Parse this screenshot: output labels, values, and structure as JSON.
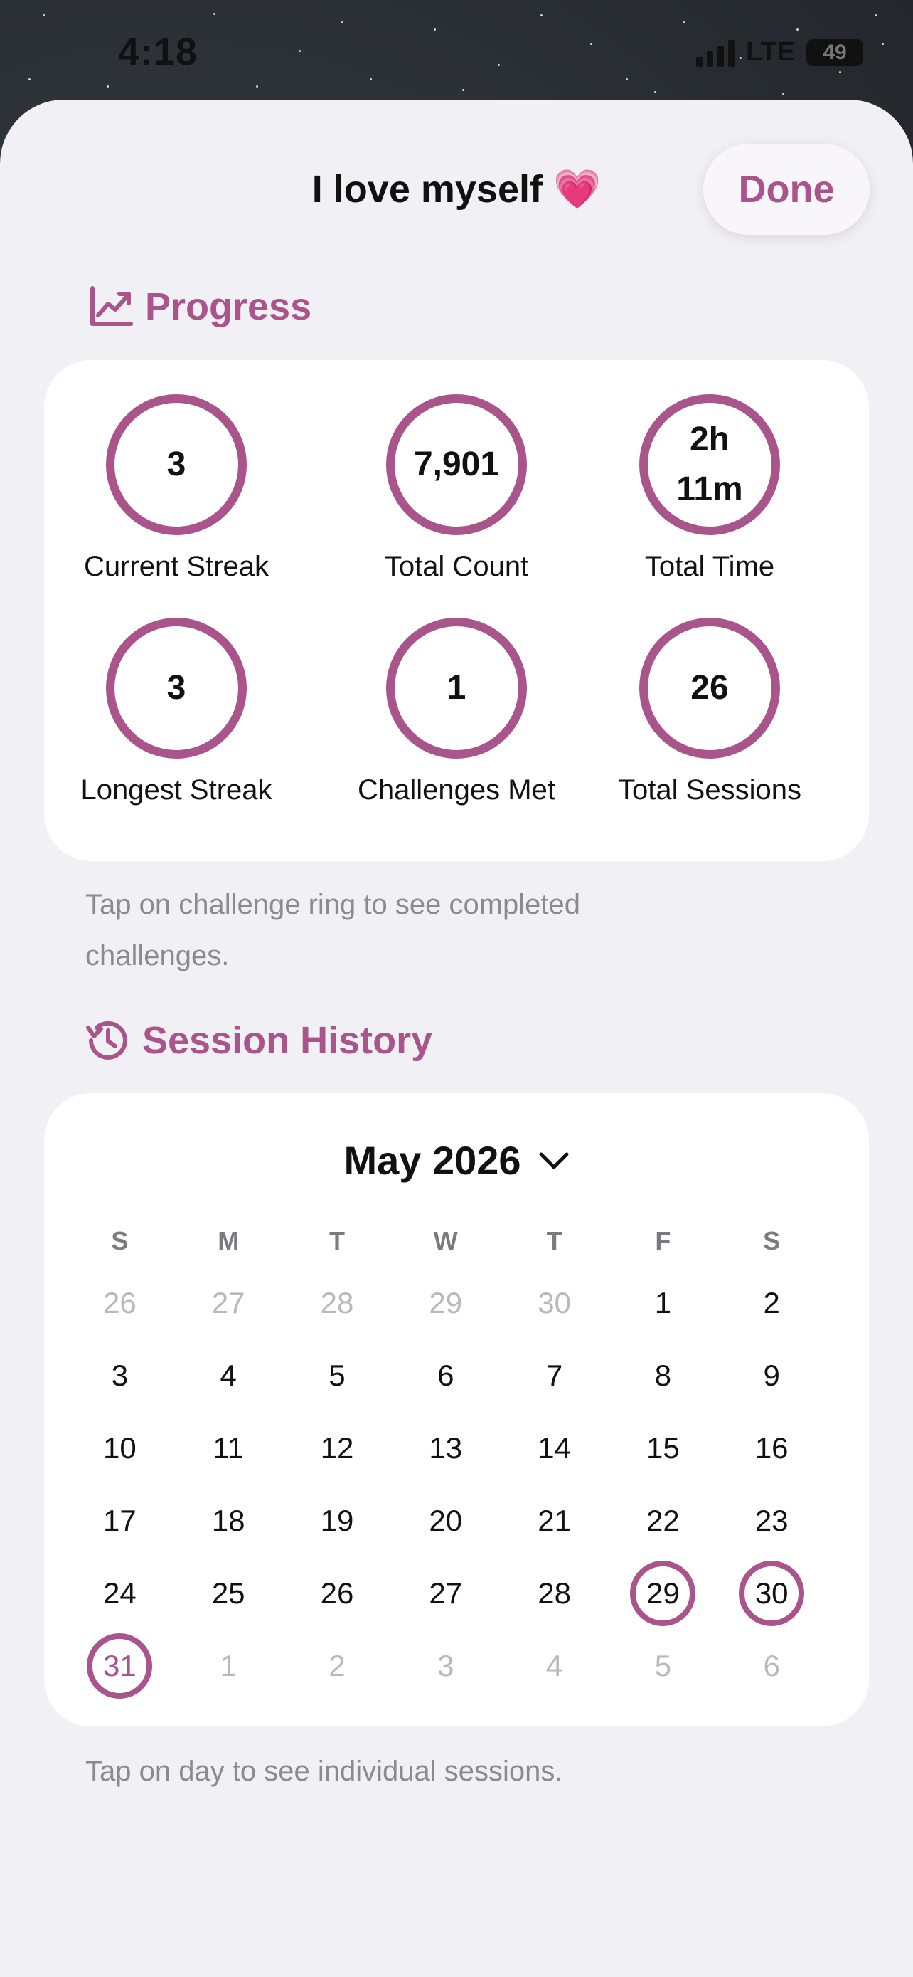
{
  "status": {
    "time": "4:18",
    "network": "LTE",
    "battery": "49"
  },
  "header": {
    "title": "I love myself 💗",
    "done_label": "Done"
  },
  "progress": {
    "title": "Progress",
    "stats": [
      {
        "value": "3",
        "label": "Current Streak"
      },
      {
        "value": "7,901",
        "label": "Total Count"
      },
      {
        "value": "2h\n11m",
        "label": "Total Time"
      },
      {
        "value": "3",
        "label": "Longest Streak"
      },
      {
        "value": "1",
        "label": "Challenges Met"
      },
      {
        "value": "26",
        "label": "Total Sessions"
      }
    ],
    "note": "Tap on challenge ring to see completed challenges."
  },
  "history": {
    "title": "Session History",
    "month_label": "May 2026",
    "weekdays": [
      "S",
      "M",
      "T",
      "W",
      "T",
      "F",
      "S"
    ],
    "weeks": [
      [
        {
          "d": "26",
          "m": true
        },
        {
          "d": "27",
          "m": true
        },
        {
          "d": "28",
          "m": true
        },
        {
          "d": "29",
          "m": true
        },
        {
          "d": "30",
          "m": true
        },
        {
          "d": "1"
        },
        {
          "d": "2"
        }
      ],
      [
        {
          "d": "3"
        },
        {
          "d": "4"
        },
        {
          "d": "5"
        },
        {
          "d": "6"
        },
        {
          "d": "7"
        },
        {
          "d": "8"
        },
        {
          "d": "9"
        }
      ],
      [
        {
          "d": "10"
        },
        {
          "d": "11"
        },
        {
          "d": "12"
        },
        {
          "d": "13"
        },
        {
          "d": "14"
        },
        {
          "d": "15"
        },
        {
          "d": "16"
        }
      ],
      [
        {
          "d": "17"
        },
        {
          "d": "18"
        },
        {
          "d": "19"
        },
        {
          "d": "20"
        },
        {
          "d": "21"
        },
        {
          "d": "22"
        },
        {
          "d": "23"
        }
      ],
      [
        {
          "d": "24"
        },
        {
          "d": "25"
        },
        {
          "d": "26"
        },
        {
          "d": "27"
        },
        {
          "d": "28"
        },
        {
          "d": "29",
          "r": true
        },
        {
          "d": "30",
          "r": true
        }
      ],
      [
        {
          "d": "31",
          "r": true,
          "a": true
        },
        {
          "d": "1",
          "m": true
        },
        {
          "d": "2",
          "m": true
        },
        {
          "d": "3",
          "m": true
        },
        {
          "d": "4",
          "m": true
        },
        {
          "d": "5",
          "m": true
        },
        {
          "d": "6",
          "m": true
        }
      ]
    ],
    "note": "Tap on day to see individual sessions."
  },
  "colors": {
    "accent": "#a9548a",
    "sheet": "#f1f0f5",
    "card": "#ffffff"
  }
}
